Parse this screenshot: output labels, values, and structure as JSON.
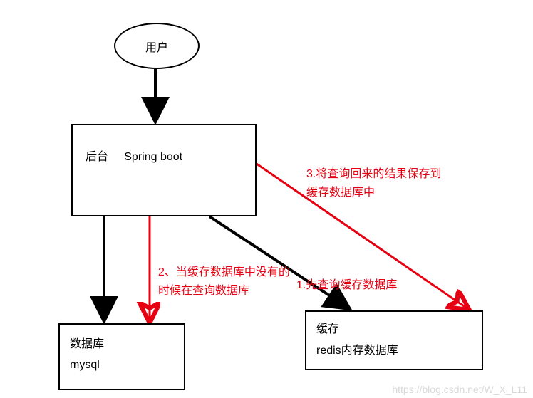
{
  "nodes": {
    "user": {
      "label": "用户"
    },
    "backend": {
      "label1": "后台",
      "label2": "Spring boot"
    },
    "db": {
      "label1": "数据库",
      "label2": "mysql"
    },
    "cache": {
      "label1": "缓存",
      "label2": "redis内存数据库"
    }
  },
  "annotations": {
    "step1": "1.先查询缓存数据库",
    "step2": "2、当缓存数据库中没有的时候在查询数据库",
    "step3": "3.将查询回来的结果保存到缓存数据库中"
  },
  "edges": [
    {
      "from": "user",
      "to": "backend",
      "color": "black"
    },
    {
      "from": "backend",
      "to": "db",
      "color": "black"
    },
    {
      "from": "backend",
      "to": "cache",
      "color": "black",
      "note": "step1"
    },
    {
      "from": "backend",
      "to": "db",
      "color": "red",
      "note": "step2"
    },
    {
      "from": "backend",
      "to": "cache",
      "color": "red",
      "via": "top-right",
      "note": "step3"
    }
  ],
  "watermark": "https://blog.csdn.net/W_X_L11"
}
